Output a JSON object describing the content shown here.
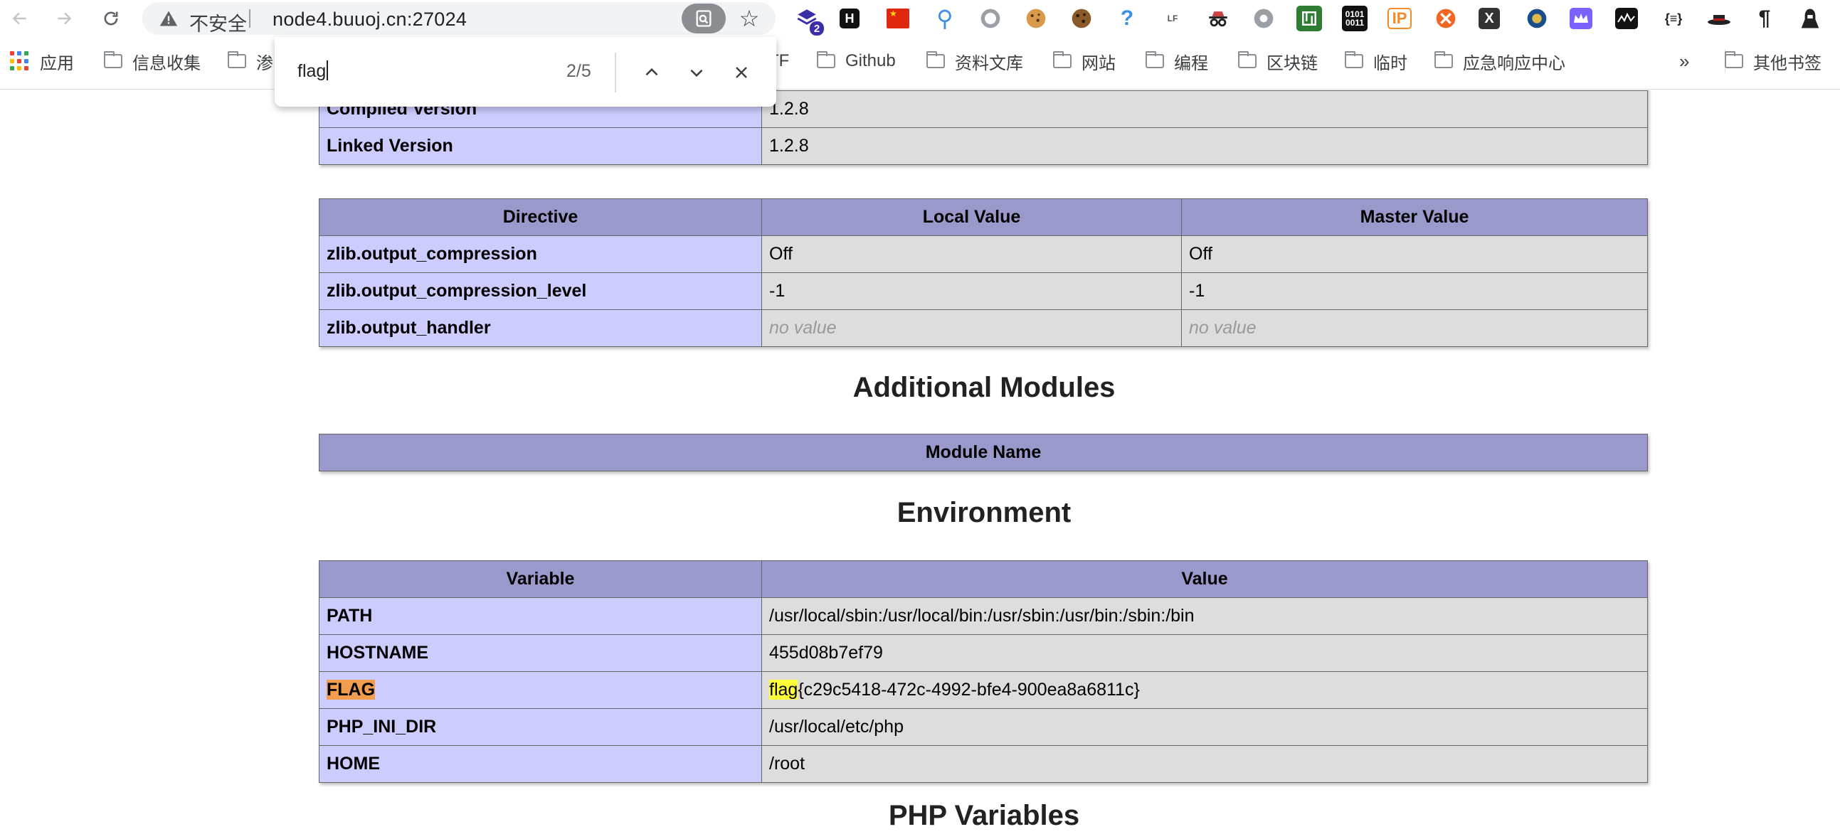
{
  "browser": {
    "address_bar": {
      "security_label": "不安全",
      "url": "node4.buuoj.cn:27024"
    },
    "extension_badge_count": "2",
    "bookmarks": [
      {
        "label": "应用",
        "type": "apps"
      },
      {
        "label": "信息收集",
        "type": "folder"
      },
      {
        "label": "渗",
        "type": "folder"
      },
      {
        "label": "TF",
        "type": "folder"
      },
      {
        "label": "Github",
        "type": "folder"
      },
      {
        "label": "资料文库",
        "type": "folder"
      },
      {
        "label": "网站",
        "type": "folder"
      },
      {
        "label": "编程",
        "type": "folder"
      },
      {
        "label": "区块链",
        "type": "folder"
      },
      {
        "label": "临时",
        "type": "folder"
      },
      {
        "label": "应急响应中心",
        "type": "folder"
      }
    ],
    "bookmarks_overflow": "»",
    "other_bookmarks": "其他书签",
    "find_bar": {
      "query": "flag",
      "count": "2/5"
    }
  },
  "page": {
    "version_table": [
      {
        "name": "Compiled Version",
        "value": "1.2.8"
      },
      {
        "name": "Linked Version",
        "value": "1.2.8"
      }
    ],
    "directive_table": {
      "headers": [
        "Directive",
        "Local Value",
        "Master Value"
      ],
      "rows": [
        {
          "name": "zlib.output_compression",
          "local": "Off",
          "master": "Off"
        },
        {
          "name": "zlib.output_compression_level",
          "local": "-1",
          "master": "-1"
        },
        {
          "name": "zlib.output_handler",
          "local": "no value",
          "master": "no value"
        }
      ]
    },
    "additional_modules": {
      "title": "Additional Modules",
      "header": "Module Name"
    },
    "environment": {
      "title": "Environment",
      "headers": [
        "Variable",
        "Value"
      ],
      "rows": [
        {
          "name": "PATH",
          "value": "/usr/local/sbin:/usr/local/bin:/usr/sbin:/usr/bin:/sbin:/bin"
        },
        {
          "name": "HOSTNAME",
          "value": "455d08b7ef79"
        },
        {
          "name": "FLAG",
          "value_match": "flag",
          "value_rest": "{c29c5418-472c-4992-bfe4-900ea8a6811c}"
        },
        {
          "name": "PHP_INI_DIR",
          "value": "/usr/local/etc/php"
        },
        {
          "name": "HOME",
          "value": "/root"
        }
      ]
    },
    "php_variables_title": "PHP Variables"
  }
}
